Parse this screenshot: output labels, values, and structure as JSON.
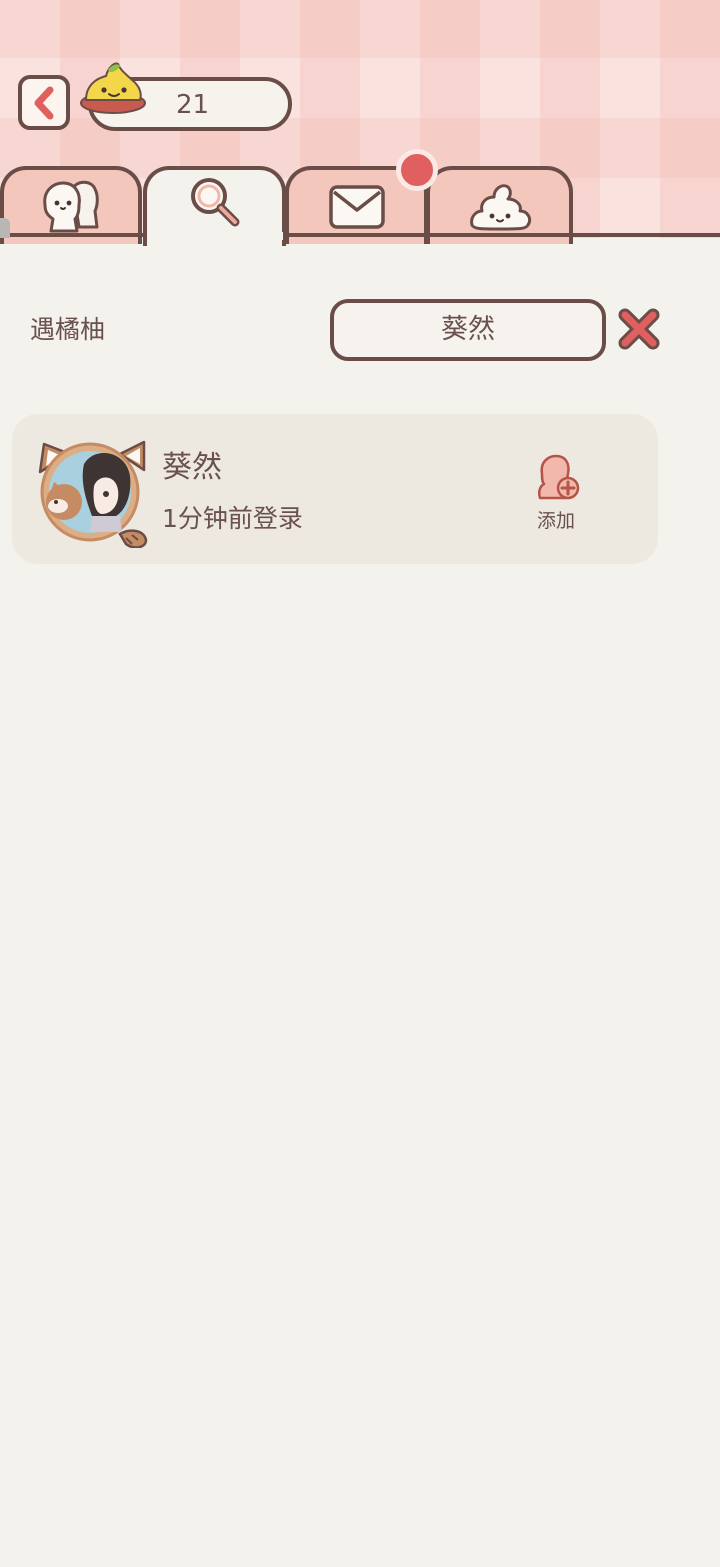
{
  "header": {
    "back_icon": "chevron-left-icon",
    "coin": {
      "icon": "jelly-blob-icon",
      "count": "21"
    }
  },
  "tabs": [
    {
      "icon": "friends-icon",
      "active": false
    },
    {
      "icon": "search-icon",
      "active": true
    },
    {
      "icon": "mail-icon",
      "active": false,
      "has_notification": true
    },
    {
      "icon": "blob-icon",
      "active": false
    }
  ],
  "search": {
    "my_name": "遇橘柚",
    "query": "葵然",
    "clear_icon": "close-x-icon"
  },
  "results": [
    {
      "name": "葵然",
      "status": "1分钟前登录",
      "avatar_icon": "raccoon-frame-avatar",
      "add_label": "添加",
      "add_icon": "add-friend-icon"
    }
  ],
  "colors": {
    "outline": "#6b4d48",
    "text": "#6a5150",
    "background": "#f4f2ed",
    "tab_fill": "#f3c7bc",
    "card_fill": "#ede9e0",
    "accent_red": "#e06060",
    "coin_yellow": "#f3d64a"
  }
}
